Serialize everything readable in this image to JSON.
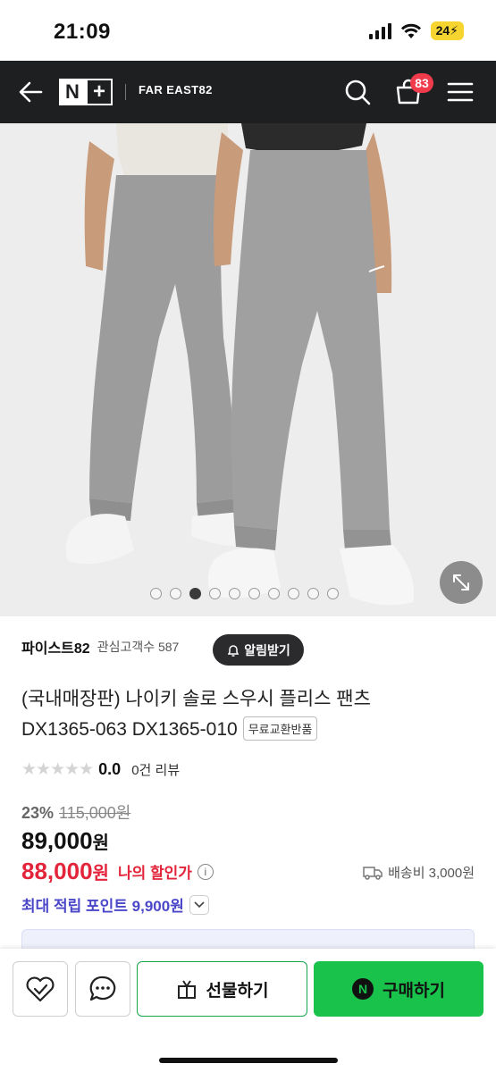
{
  "status": {
    "time": "21:09",
    "battery": "24"
  },
  "header": {
    "store_name": "FAR EAST82",
    "cart_count": "83",
    "logo_n": "N",
    "logo_plus": "+"
  },
  "gallery": {
    "total_images": 10,
    "active_index": 3
  },
  "seller": {
    "name": "파이스트82",
    "fans_label": "관심고객수 587",
    "alarm_label": "알림받기"
  },
  "product": {
    "title_line1": "(국내매장판) 나이키 솔로 스우시 플리스 팬츠",
    "title_line2": "DX1365-063 DX1365-010",
    "free_badge": "무료교환반품"
  },
  "rating": {
    "stars": "★★★★★",
    "score": "0.0",
    "reviews": "0건 리뷰"
  },
  "price": {
    "discount_rate": "23%",
    "original": "115,000원",
    "sale": "89,000",
    "won": "원",
    "my_price": "88,000",
    "my_label": "나의 할인가",
    "shipping": "배송비 3,000원",
    "points": "최대 적립 포인트 9,900원"
  },
  "actions": {
    "gift": "선물하기",
    "buy": "구매하기"
  },
  "colors": {
    "header_bg": "#1d1f21",
    "badge": "#ef3b4c",
    "accent_red": "#e3243b",
    "points": "#4b47c9",
    "buy_green": "#19c24b"
  }
}
